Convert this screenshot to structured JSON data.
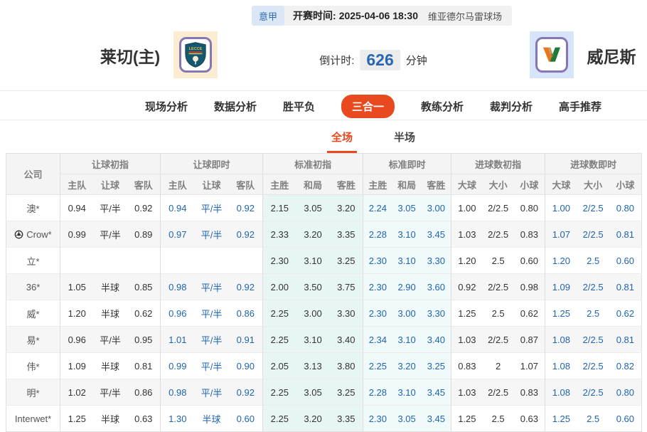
{
  "topbar": {
    "league": "意甲",
    "kickoff_label": "开赛时间:",
    "kickoff_time": "2025-04-06 18:30",
    "venue": "维亚德尔马雷球场"
  },
  "header": {
    "home_name": "莱切(主)",
    "away_name": "威尼斯",
    "countdown_label": "倒计时:",
    "countdown_value": "626",
    "countdown_unit": "分钟"
  },
  "nav": {
    "tabs": [
      {
        "id": "scene",
        "label": "现场分析",
        "active": false
      },
      {
        "id": "data",
        "label": "数据分析",
        "active": false
      },
      {
        "id": "wdl",
        "label": "胜平负",
        "active": false
      },
      {
        "id": "three-in-one",
        "label": "三合一",
        "active": true
      },
      {
        "id": "coach",
        "label": "教练分析",
        "active": false
      },
      {
        "id": "referee",
        "label": "裁判分析",
        "active": false
      },
      {
        "id": "expert",
        "label": "高手推荐",
        "active": false
      }
    ]
  },
  "subtabs": {
    "full": "全场",
    "half": "半场"
  },
  "table": {
    "company_header": "公司",
    "groups": [
      {
        "label": "让球初指",
        "cols": [
          "主队",
          "让球",
          "客队"
        ]
      },
      {
        "label": "让球即时",
        "cols": [
          "主队",
          "让球",
          "客队"
        ]
      },
      {
        "label": "标准初指",
        "cols": [
          "主胜",
          "和局",
          "客胜"
        ]
      },
      {
        "label": "标准即时",
        "cols": [
          "主胜",
          "和局",
          "客胜"
        ]
      },
      {
        "label": "进球数初指",
        "cols": [
          "大球",
          "大小",
          "小球"
        ]
      },
      {
        "label": "进球数即时",
        "cols": [
          "大球",
          "大小",
          "小球"
        ]
      }
    ],
    "rows": [
      {
        "company": "澳*",
        "has_icon": false,
        "cells": [
          [
            "0.94",
            "平/半",
            "0.92"
          ],
          [
            "0.94",
            "平/半",
            "0.92"
          ],
          [
            "2.15",
            "3.05",
            "3.20"
          ],
          [
            "2.24",
            "3.05",
            "3.00"
          ],
          [
            "1.00",
            "2/2.5",
            "0.80"
          ],
          [
            "1.00",
            "2/2.5",
            "0.80"
          ]
        ]
      },
      {
        "company": "Crow*",
        "has_icon": true,
        "cells": [
          [
            "0.99",
            "平/半",
            "0.89"
          ],
          [
            "0.97",
            "平/半",
            "0.92"
          ],
          [
            "2.33",
            "3.20",
            "3.35"
          ],
          [
            "2.28",
            "3.10",
            "3.45"
          ],
          [
            "1.03",
            "2/2.5",
            "0.83"
          ],
          [
            "1.07",
            "2/2.5",
            "0.81"
          ]
        ]
      },
      {
        "company": "立*",
        "has_icon": false,
        "cells": [
          [
            "",
            "",
            ""
          ],
          [
            "",
            "",
            ""
          ],
          [
            "2.30",
            "3.10",
            "3.25"
          ],
          [
            "2.30",
            "3.10",
            "3.30"
          ],
          [
            "1.20",
            "2.5",
            "0.60"
          ],
          [
            "1.20",
            "2.5",
            "0.60"
          ]
        ]
      },
      {
        "company": "36*",
        "has_icon": false,
        "cells": [
          [
            "1.05",
            "半球",
            "0.85"
          ],
          [
            "0.98",
            "平/半",
            "0.92"
          ],
          [
            "2.00",
            "3.50",
            "3.75"
          ],
          [
            "2.30",
            "2.90",
            "3.60"
          ],
          [
            "0.92",
            "2/2.5",
            "0.98"
          ],
          [
            "1.09",
            "2/2.5",
            "0.81"
          ]
        ]
      },
      {
        "company": "威*",
        "has_icon": false,
        "cells": [
          [
            "1.20",
            "半球",
            "0.62"
          ],
          [
            "0.96",
            "平/半",
            "0.86"
          ],
          [
            "2.25",
            "3.00",
            "3.30"
          ],
          [
            "2.30",
            "3.00",
            "3.30"
          ],
          [
            "1.25",
            "2.5",
            "0.62"
          ],
          [
            "1.25",
            "2.5",
            "0.62"
          ]
        ]
      },
      {
        "company": "易*",
        "has_icon": false,
        "cells": [
          [
            "0.96",
            "平/半",
            "0.95"
          ],
          [
            "1.01",
            "平/半",
            "0.91"
          ],
          [
            "2.25",
            "3.10",
            "3.40"
          ],
          [
            "2.34",
            "3.10",
            "3.40"
          ],
          [
            "1.03",
            "2/2.5",
            "0.87"
          ],
          [
            "1.08",
            "2/2.5",
            "0.81"
          ]
        ]
      },
      {
        "company": "伟*",
        "has_icon": false,
        "cells": [
          [
            "1.09",
            "半球",
            "0.81"
          ],
          [
            "0.99",
            "平/半",
            "0.90"
          ],
          [
            "2.05",
            "3.13",
            "3.80"
          ],
          [
            "2.25",
            "3.20",
            "3.25"
          ],
          [
            "0.83",
            "2",
            "1.07"
          ],
          [
            "1.08",
            "2/2.5",
            "0.82"
          ]
        ]
      },
      {
        "company": "明*",
        "has_icon": false,
        "cells": [
          [
            "1.02",
            "平/半",
            "0.86"
          ],
          [
            "0.98",
            "平/半",
            "0.92"
          ],
          [
            "2.25",
            "3.05",
            "3.25"
          ],
          [
            "2.28",
            "3.10",
            "3.45"
          ],
          [
            "1.03",
            "2/2.5",
            "0.83"
          ],
          [
            "1.08",
            "2/2.5",
            "0.80"
          ]
        ]
      },
      {
        "company": "Interwet*",
        "has_icon": false,
        "cells": [
          [
            "1.25",
            "半球",
            "0.63"
          ],
          [
            "1.30",
            "半球",
            "0.60"
          ],
          [
            "2.25",
            "3.20",
            "3.35"
          ],
          [
            "2.30",
            "3.05",
            "3.45"
          ],
          [
            "1.25",
            "2.5",
            "0.63"
          ],
          [
            "1.25",
            "2.5",
            "0.60"
          ]
        ]
      }
    ]
  },
  "colors": {
    "accent_red": "#e8491e",
    "live_blue": "#2065b0",
    "badge_blue": "#2b6cb5",
    "cyan_init": "#e7f5f3",
    "cyan_live": "#f0fafa"
  }
}
